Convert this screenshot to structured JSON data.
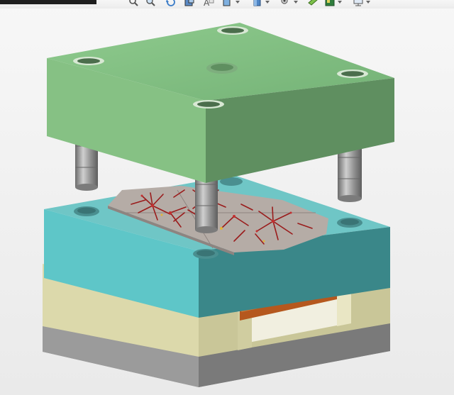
{
  "window": {
    "title": ""
  },
  "toolbar": {
    "icons": [
      {
        "name": "zoom-to-fit-icon"
      },
      {
        "name": "zoom-to-area-icon"
      },
      {
        "name": "previous-view-icon"
      },
      {
        "name": "section-view-icon"
      },
      {
        "name": "dynamic-annotation-icon"
      },
      {
        "name": "view-orientation-icon"
      },
      {
        "name": "display-style-icon"
      },
      {
        "name": "hide-show-items-icon"
      },
      {
        "name": "edit-appearance-icon"
      },
      {
        "name": "apply-scene-icon"
      },
      {
        "name": "view-settings-icon"
      }
    ]
  },
  "model": {
    "name": "injection-mold-assembly",
    "colors": {
      "top_plate": "#8cc68a",
      "cavity_plate": "#5ec6c8",
      "support_plate": "#d9d6a8",
      "base_plate": "#8a8a8a",
      "guide_pin": "#9a9a9a",
      "cavity_insert": "#b8aea8",
      "runner_marks": "#9a1c1c",
      "ejector_plate": "#b5581e"
    }
  }
}
